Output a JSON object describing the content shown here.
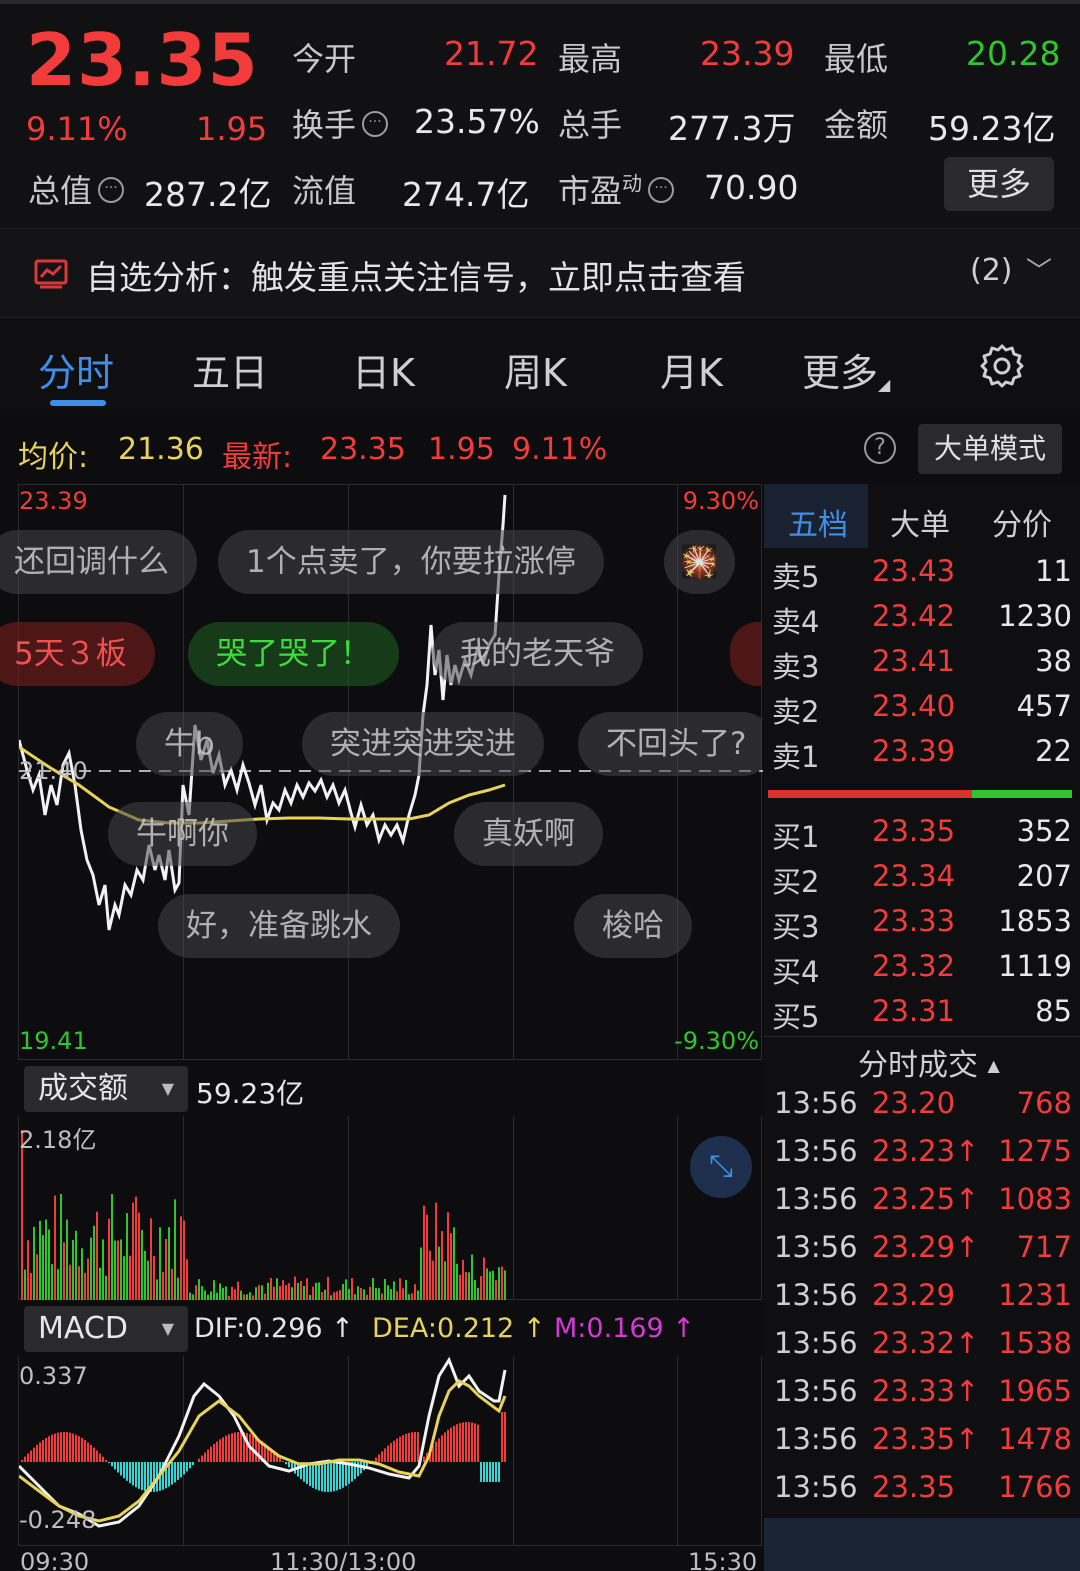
{
  "quote": {
    "price": "23.35",
    "change_pct": "9.11%",
    "change_amt": "1.95",
    "open_label": "今开",
    "open": "21.72",
    "high_label": "最高",
    "high": "23.39",
    "low_label": "最低",
    "low": "20.28",
    "turnover_label": "换手",
    "turnover": "23.57%",
    "total_vol_label": "总手",
    "total_vol": "277.3万",
    "amount_label": "金额",
    "amount": "59.23亿",
    "mktcap_label": "总值",
    "mktcap": "287.2亿",
    "float_label": "流值",
    "float_cap": "274.7亿",
    "pe_label": "市盈",
    "pe_sup": "动",
    "pe": "70.90",
    "more": "更多"
  },
  "banner": {
    "text": "自选分析：触发重点关注信号，立即点击查看",
    "count": "(2)"
  },
  "tabs": [
    "分时",
    "五日",
    "日K",
    "周K",
    "月K",
    "更多"
  ],
  "avg_row": {
    "avg_label": "均价:",
    "avg": "21.36",
    "latest_label": "最新:",
    "latest": "23.35",
    "chg": "1.95",
    "pct": "9.11%",
    "help": "?",
    "big_order_mode": "大单模式"
  },
  "chart": {
    "y_top": "23.39",
    "y_mid": "21.40",
    "y_bot": "19.41",
    "pct_top": "9.30%",
    "pct_bot": "-9.30%",
    "x_labels": [
      "09:30",
      "11:30/13:00",
      "15:30"
    ]
  },
  "danmaku": [
    "还回调什么",
    "1个点卖了，你要拉涨停",
    "5天３板",
    "哭了哭了！",
    "我的老天爷",
    "牛b",
    "突进突进突进",
    "不回头了?",
    "牛啊你",
    "真妖啊",
    "好，准备跳水",
    "梭哈"
  ],
  "volume": {
    "label": "成交额",
    "value": "59.23亿",
    "max": "2.18亿"
  },
  "macd": {
    "label": "MACD",
    "dif": "DIF:0.296 ↑",
    "dea": "DEA:0.212 ↑",
    "m": "M:0.169 ↑",
    "top": "0.337",
    "bot": "-0.248"
  },
  "book": {
    "tabs": [
      "五档",
      "大单",
      "分价"
    ],
    "asks": [
      {
        "label": "卖5",
        "price": "23.43",
        "vol": "11"
      },
      {
        "label": "卖4",
        "price": "23.42",
        "vol": "1230"
      },
      {
        "label": "卖3",
        "price": "23.41",
        "vol": "38"
      },
      {
        "label": "卖2",
        "price": "23.40",
        "vol": "457"
      },
      {
        "label": "卖1",
        "price": "23.39",
        "vol": "22"
      }
    ],
    "bids": [
      {
        "label": "买1",
        "price": "23.35",
        "vol": "352"
      },
      {
        "label": "买2",
        "price": "23.34",
        "vol": "207"
      },
      {
        "label": "买3",
        "price": "23.33",
        "vol": "1853"
      },
      {
        "label": "买4",
        "price": "23.32",
        "vol": "1119"
      },
      {
        "label": "买5",
        "price": "23.31",
        "vol": "85"
      }
    ],
    "ticks_title": "分时成交",
    "ticks": [
      {
        "time": "13:56",
        "price": "23.20",
        "vol": "768"
      },
      {
        "time": "13:56",
        "price": "23.23↑",
        "vol": "1275"
      },
      {
        "time": "13:56",
        "price": "23.25↑",
        "vol": "1083"
      },
      {
        "time": "13:56",
        "price": "23.29↑",
        "vol": "717"
      },
      {
        "time": "13:56",
        "price": "23.29",
        "vol": "1231"
      },
      {
        "time": "13:56",
        "price": "23.32↑",
        "vol": "1538"
      },
      {
        "time": "13:56",
        "price": "23.33↑",
        "vol": "1965"
      },
      {
        "time": "13:56",
        "price": "23.35↑",
        "vol": "1478"
      },
      {
        "time": "13:56",
        "price": "23.35",
        "vol": "1766"
      }
    ]
  },
  "colors": {
    "up": "#f23b3b",
    "down": "#2fc52f",
    "accent": "#3f8ee8",
    "avg_line": "#e8d35a"
  }
}
